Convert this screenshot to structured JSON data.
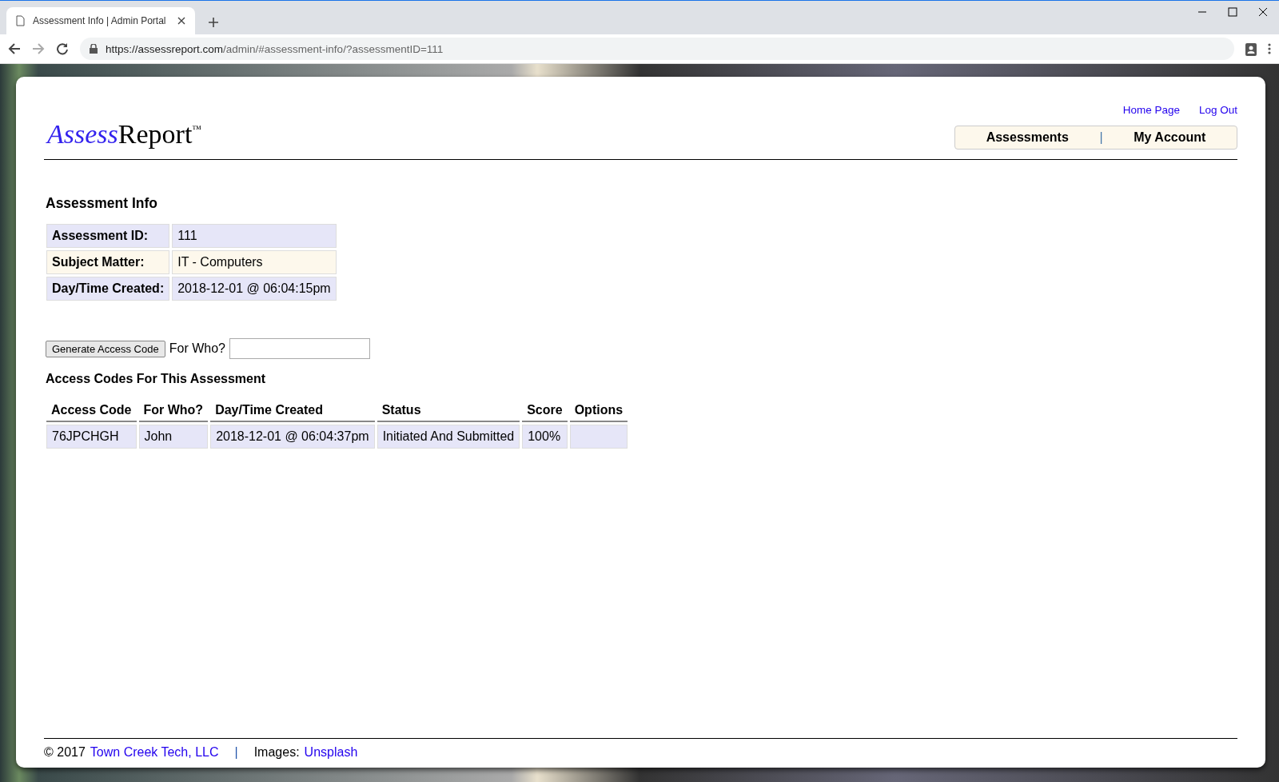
{
  "browser": {
    "tab_title": "Assessment Info | Admin Portal",
    "url_host": "https://assessreport.com",
    "url_path": "/admin/#assessment-info/?assessmentID=111"
  },
  "header": {
    "logo": {
      "first": "Assess",
      "second": "Report",
      "mark": "™"
    },
    "top_links": [
      "Home Page",
      "Log Out"
    ],
    "nav": [
      "Assessments",
      "|",
      "My Account"
    ]
  },
  "info": {
    "title": "Assessment Info",
    "rows": [
      {
        "label": "Assessment ID:",
        "value": "111"
      },
      {
        "label": "Subject Matter:",
        "value": "IT - Computers"
      },
      {
        "label": "Day/Time Created:",
        "value": "2018-12-01 @ 06:04:15pm"
      }
    ]
  },
  "generate": {
    "button": "Generate Access Code",
    "label": "For Who?"
  },
  "codes": {
    "title": "Access Codes For This Assessment",
    "columns": [
      "Access Code",
      "For Who?",
      "Day/Time Created",
      "Status",
      "Score",
      "Options"
    ],
    "rows": [
      [
        "76JPCHGH",
        "John",
        "2018-12-01 @ 06:04:37pm",
        "Initiated And Submitted",
        "100%",
        ""
      ]
    ]
  },
  "footer": {
    "copyright": "© 2017",
    "company": "Town Creek Tech, LLC",
    "separator": "|",
    "images_label": "Images:",
    "images_link": "Unsplash"
  }
}
